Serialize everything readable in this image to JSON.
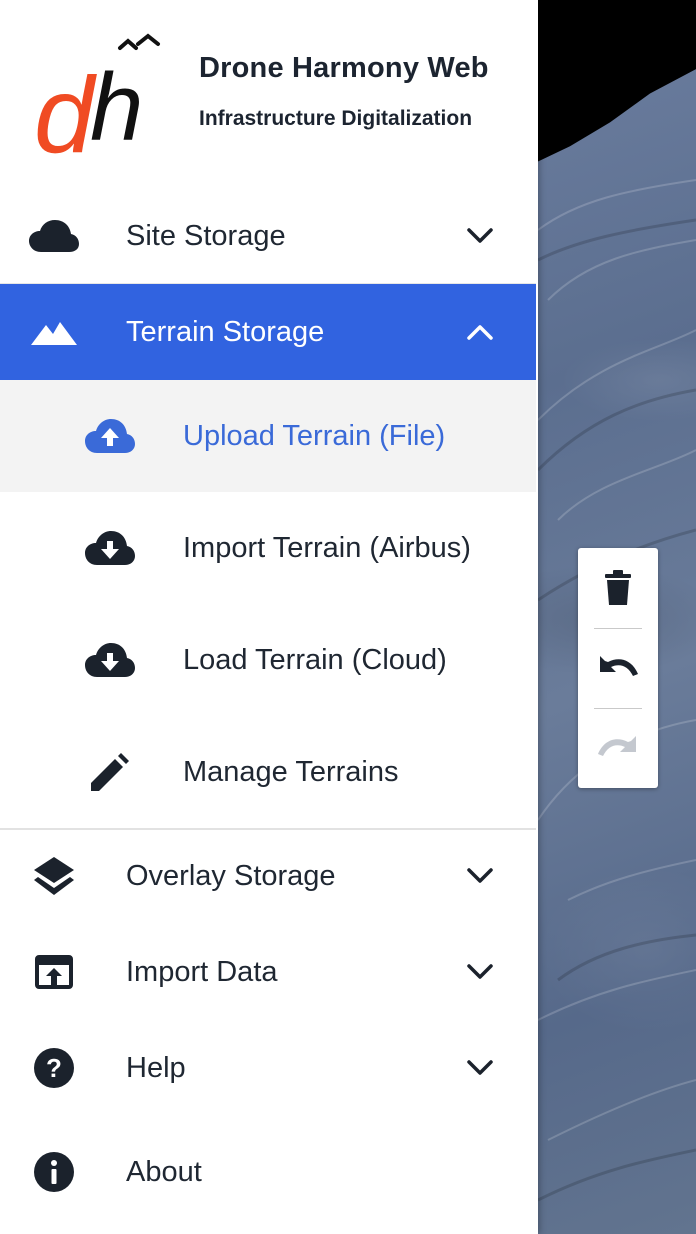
{
  "app": {
    "title": "Drone Harmony Web",
    "subtitle": "Infrastructure Digitalization",
    "logo_text": "dh"
  },
  "colors": {
    "accent": "#3163e0",
    "selected_text": "#3a6ad8",
    "logo_orange": "#f04b23",
    "text": "#1f2732"
  },
  "menu": {
    "site_storage": {
      "label": "Site Storage",
      "icon": "cloud-icon",
      "expanded": false
    },
    "terrain_storage": {
      "label": "Terrain Storage",
      "icon": "mountain-icon",
      "expanded": true,
      "items": [
        {
          "label": "Upload Terrain (File)",
          "icon": "cloud-upload-icon",
          "selected": true
        },
        {
          "label": "Import Terrain (Airbus)",
          "icon": "cloud-download-icon"
        },
        {
          "label": "Load Terrain (Cloud)",
          "icon": "cloud-download-icon"
        },
        {
          "label": "Manage Terrains",
          "icon": "pencil-icon"
        }
      ]
    },
    "overlay_storage": {
      "label": "Overlay Storage",
      "icon": "layers-icon",
      "expanded": false
    },
    "import_data": {
      "label": "Import Data",
      "icon": "open-in-browser-icon",
      "expanded": false
    },
    "help": {
      "label": "Help",
      "icon": "help-circle-icon",
      "expanded": false
    },
    "about": {
      "label": "About",
      "icon": "info-circle-icon"
    }
  },
  "toolbar": {
    "delete_icon": "trash-icon",
    "undo_icon": "undo-icon",
    "redo_icon": "redo-icon",
    "redo_enabled": false
  }
}
